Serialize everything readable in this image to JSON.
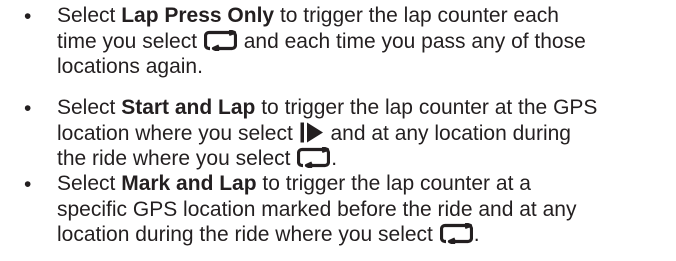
{
  "items": [
    {
      "bullet": "•",
      "l1_a": "Select ",
      "l1_bold": "Lap Press Only",
      "l1_b": " to trigger the lap counter each",
      "l2_a": "time you select ",
      "l2_icon": "lap-icon",
      "l2_b": " and each time you pass any of those",
      "l3": "locations again."
    },
    {
      "bullet": "•",
      "l1_a": "Select ",
      "l1_bold": "Start and Lap",
      "l1_b": " to trigger the lap counter at the GPS",
      "l2_a": "location where you select ",
      "l2_icon": "start-icon",
      "l2_b": " and at any location during",
      "l3_a": "the ride where you select ",
      "l3_icon": "lap-icon",
      "l3_b": "."
    },
    {
      "bullet": "•",
      "l1_a": "Select ",
      "l1_bold": "Mark and Lap",
      "l1_b": " to trigger the lap counter at a",
      "l2": "specific GPS location marked before the ride and at any",
      "l3_a": "location during the ride where you select ",
      "l3_icon": "lap-icon",
      "l3_b": "."
    }
  ],
  "colors": {
    "text": "#231f20",
    "background": "#ffffff"
  }
}
